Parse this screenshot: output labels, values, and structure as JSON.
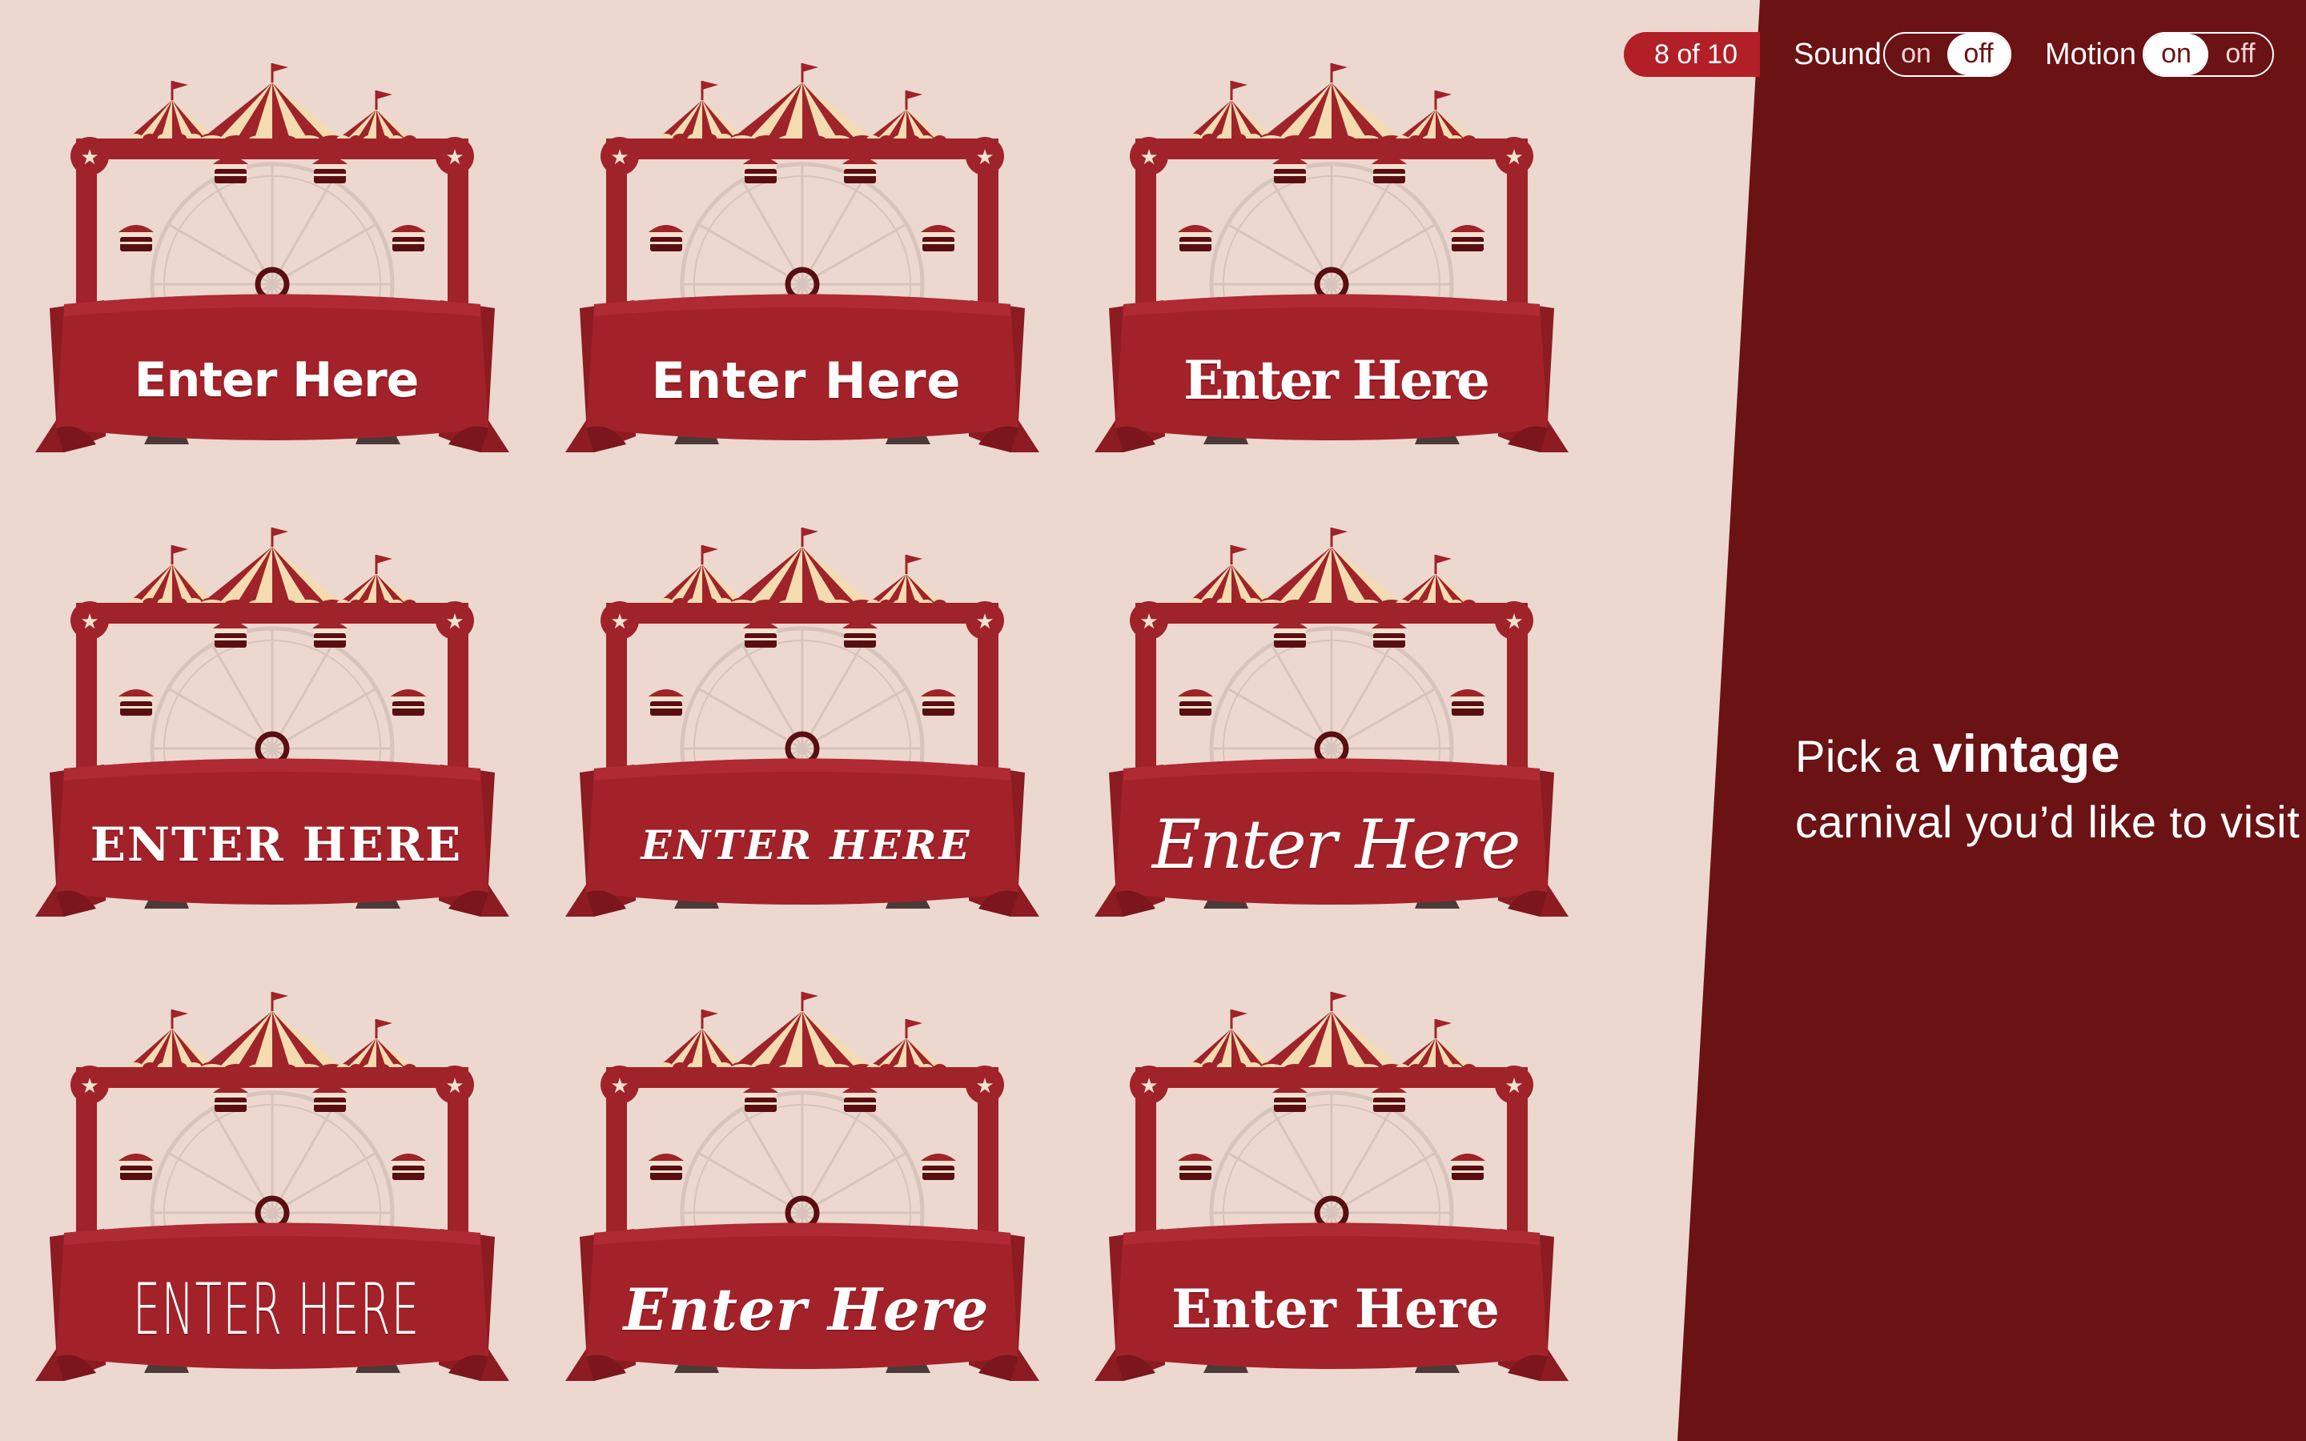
{
  "progress": {
    "label": "8 of 10"
  },
  "sound": {
    "label": "Sound",
    "on_label": "on",
    "off_label": "off",
    "state": "off"
  },
  "motion": {
    "label": "Motion",
    "on_label": "on",
    "off_label": "off",
    "state": "on"
  },
  "prompt": {
    "pre": "Pick a",
    "emphasis": "vintage",
    "post": "carnival you’d like to visit"
  },
  "colors": {
    "background": "#ecd8cf",
    "panel": "#6b1214",
    "accent": "#b21f27",
    "banner": "#a3222a",
    "frame": "#a0232a",
    "tent_cream": "#f4dcb0"
  },
  "cards": [
    {
      "label": "Enter Here",
      "style": "grunge-slab"
    },
    {
      "label": "Enter Here",
      "style": "bold-sans"
    },
    {
      "label": "Enter Here",
      "style": "stencil-slab"
    },
    {
      "label": "ENTER HERE",
      "style": "inline-western"
    },
    {
      "label": "ENTER HERE",
      "style": "circus-tuscan"
    },
    {
      "label": "Enter Here",
      "style": "script"
    },
    {
      "label": "ENTER HERE",
      "style": "condensed-hairline"
    },
    {
      "label": "Enter Here",
      "style": "brush-script"
    },
    {
      "label": "Enter Here",
      "style": "heavy-slab"
    }
  ]
}
